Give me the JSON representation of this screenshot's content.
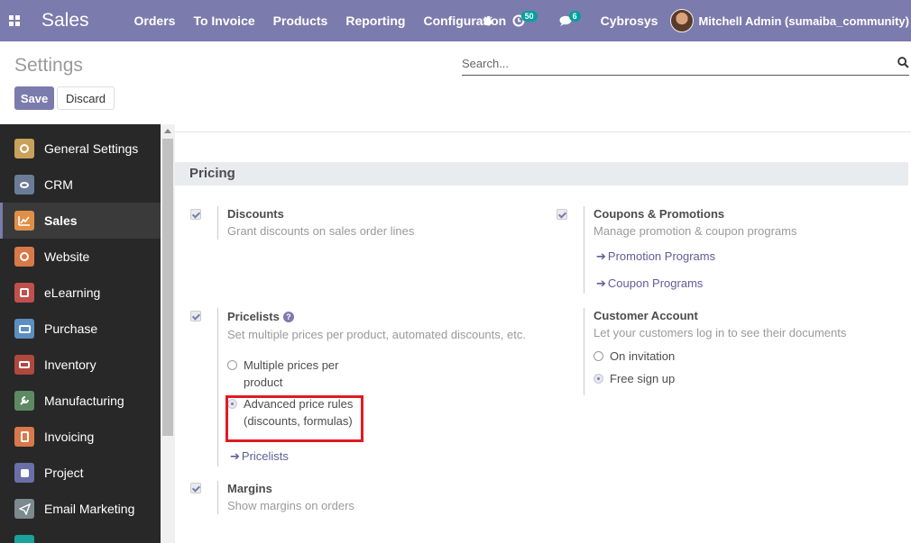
{
  "navbar": {
    "brand": "Sales",
    "menu": [
      "Orders",
      "To Invoice",
      "Products",
      "Reporting",
      "Configuration"
    ],
    "activity_count": "50",
    "message_count": "6",
    "company": "Cybrosys",
    "user": "Mitchell Admin (sumaiba_community)",
    "color": "#7c7bad"
  },
  "control_panel": {
    "title": "Settings",
    "search_placeholder": "Search...",
    "save_label": "Save",
    "discard_label": "Discard"
  },
  "sidebar": {
    "items": [
      {
        "label": "General Settings",
        "icon": "gear-icon",
        "color": "#c8a15b"
      },
      {
        "label": "CRM",
        "icon": "handshake-icon",
        "color": "#6b7d96"
      },
      {
        "label": "Sales",
        "icon": "chart-icon",
        "color": "#e09046"
      },
      {
        "label": "Website",
        "icon": "globe-icon",
        "color": "#d9794a"
      },
      {
        "label": "eLearning",
        "icon": "elearning-icon",
        "color": "#c0504d"
      },
      {
        "label": "Purchase",
        "icon": "purchase-icon",
        "color": "#5c8fbf"
      },
      {
        "label": "Inventory",
        "icon": "box-icon",
        "color": "#b0483e"
      },
      {
        "label": "Manufacturing",
        "icon": "wrench-icon",
        "color": "#5e8a63"
      },
      {
        "label": "Invoicing",
        "icon": "invoice-icon",
        "color": "#d9794a"
      },
      {
        "label": "Project",
        "icon": "puzzle-icon",
        "color": "#6b6fa8"
      },
      {
        "label": "Email Marketing",
        "icon": "paper-plane-icon",
        "color": "#7b8a8f"
      }
    ]
  },
  "pricing": {
    "section_title": "Pricing",
    "discounts": {
      "title": "Discounts",
      "desc": "Grant discounts on sales order lines"
    },
    "coupons": {
      "title": "Coupons & Promotions",
      "desc": "Manage promotion & coupon programs",
      "link1": "Promotion Programs",
      "link2": "Coupon Programs"
    },
    "pricelists": {
      "title": "Pricelists",
      "desc": "Set multiple prices per product, automated discounts, etc.",
      "option1_line1": "Multiple prices per",
      "option1_line2": "product",
      "option2_line1": "Advanced price rules",
      "option2_line2": "(discounts, formulas)",
      "link": "Pricelists"
    },
    "customer_account": {
      "title": "Customer Account",
      "desc": "Let your customers log in to see their documents",
      "option1": "On invitation",
      "option2": "Free sign up"
    },
    "margins": {
      "title": "Margins",
      "desc": "Show margins on orders"
    }
  }
}
